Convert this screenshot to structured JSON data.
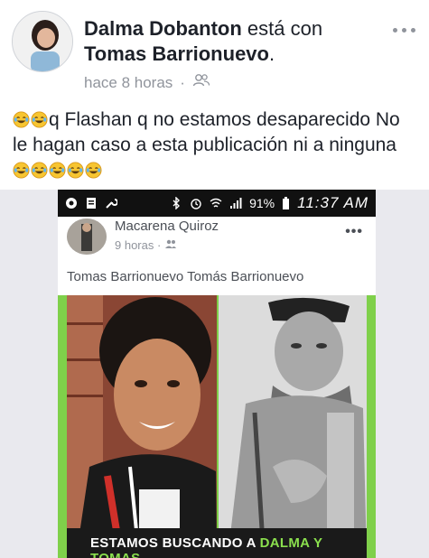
{
  "post": {
    "author": "Dalma Dobanton",
    "connector": "está con",
    "tagged": "Tomas Barrionuevo",
    "period": ".",
    "time": "hace 8 horas",
    "separator": "·",
    "audience_icon": "friends-icon",
    "more_icon": "more-dots-icon",
    "text_main": "q Flashan q no estamos desaparecido  No le hagan caso a esta publicación ni a ninguna",
    "emoji_name": "laughing-tears-emoji"
  },
  "screenshot": {
    "status_bar": {
      "battery": "91%",
      "time": "11:37 AM"
    },
    "inner_post": {
      "author": "Macarena Quiroz",
      "time": "9 horas",
      "separator": "·",
      "more": "•••",
      "text": "Tomas Barrionuevo Tomás Barrionuevo"
    },
    "poster": {
      "caption_prefix": "ESTAMOS BUSCANDO A ",
      "caption_highlight": "DALMA Y TOMAS",
      "accent_color": "#7fd04a"
    }
  }
}
